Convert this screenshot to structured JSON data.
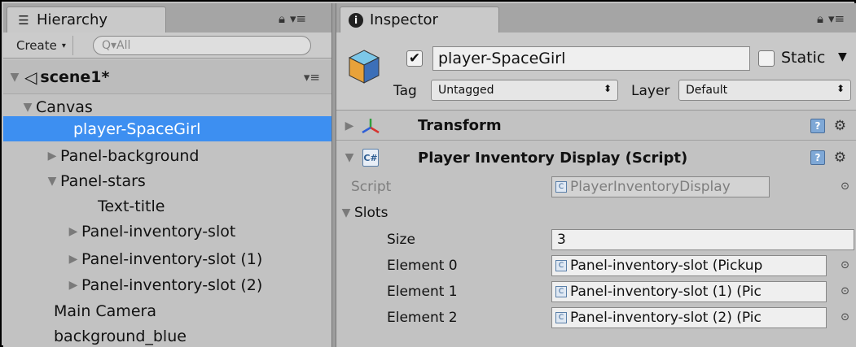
{
  "hierarchy": {
    "tab_label": "Hierarchy",
    "create_label": "Create",
    "search_placeholder": "Q▾All",
    "scene_name": "scene1*",
    "items": [
      {
        "label": "Canvas"
      },
      {
        "label": "player-SpaceGirl"
      },
      {
        "label": "Panel-background"
      },
      {
        "label": "Panel-stars"
      },
      {
        "label": "Text-title"
      },
      {
        "label": "Panel-inventory-slot"
      },
      {
        "label": "Panel-inventory-slot (1)"
      },
      {
        "label": "Panel-inventory-slot (2)"
      },
      {
        "label": "Main Camera"
      },
      {
        "label": "background_blue"
      }
    ]
  },
  "inspector": {
    "tab_label": "Inspector",
    "object_name": "player-SpaceGirl",
    "static_label": "Static",
    "tag_label": "Tag",
    "tag_value": "Untagged",
    "layer_label": "Layer",
    "layer_value": "Default",
    "transform_label": "Transform",
    "component_label": "Player Inventory Display (Script)",
    "script_label": "Script",
    "script_value": "PlayerInventoryDisplay",
    "slots_label": "Slots",
    "size_label": "Size",
    "size_value": "3",
    "elements": [
      {
        "label": "Element 0",
        "value": "Panel-inventory-slot (Pickup"
      },
      {
        "label": "Element 1",
        "value": "Panel-inventory-slot (1) (Pic"
      },
      {
        "label": "Element 2",
        "value": "Panel-inventory-slot (2) (Pic"
      }
    ]
  },
  "colors": {
    "selection": "#3d8ff1",
    "panel_bg": "#c2c2c2"
  }
}
